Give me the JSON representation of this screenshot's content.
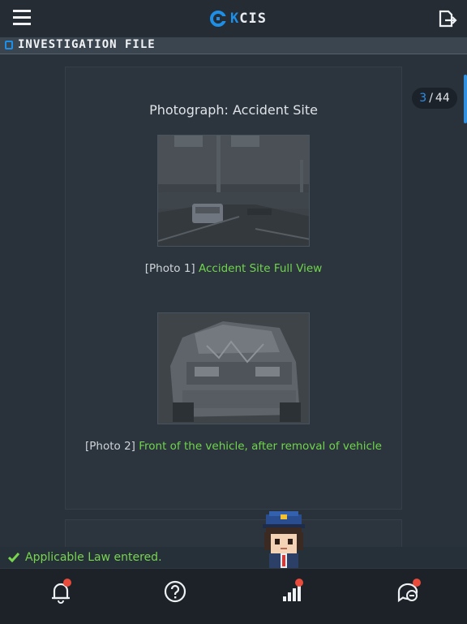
{
  "app": {
    "logo_text_prefix": "K",
    "logo_text": "CIS",
    "accent_color": "#1e8fe6"
  },
  "section": {
    "title": "INVESTIGATION FILE"
  },
  "pager": {
    "current": "3",
    "separator": "/",
    "total": "44"
  },
  "document": {
    "title": "Photograph: Accident Site",
    "photos": [
      {
        "prefix": "[Photo 1]",
        "caption": "Accident Site Full View"
      },
      {
        "prefix": "[Photo 2]",
        "caption": "Front of the vehicle, after removal of vehicle"
      }
    ]
  },
  "toast": {
    "text": "Applicable Law entered.",
    "color": "#78d54e"
  },
  "nav": {
    "items": [
      {
        "icon": "bell-icon",
        "badge": true
      },
      {
        "icon": "help-icon",
        "badge": false
      },
      {
        "icon": "stats-icon",
        "badge": true
      },
      {
        "icon": "chat-icon",
        "badge": true
      }
    ],
    "badge_color": "#e84a3b"
  }
}
